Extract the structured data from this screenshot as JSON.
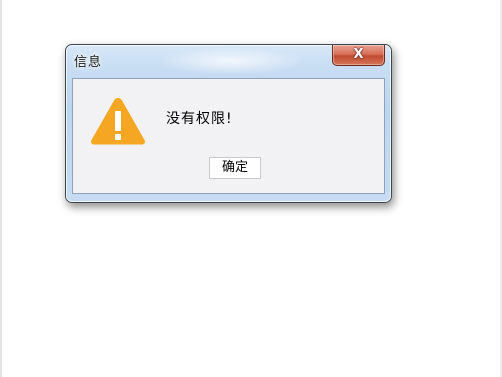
{
  "dialog": {
    "title": "信息",
    "close_label": "X",
    "message": "没有权限!",
    "ok_label": "确定",
    "icon": "warning-icon"
  },
  "colors": {
    "warning": "#f5a623",
    "close_button": "#c94a33",
    "title_bar": "#c9def3",
    "client_bg": "#f2f2f5"
  }
}
